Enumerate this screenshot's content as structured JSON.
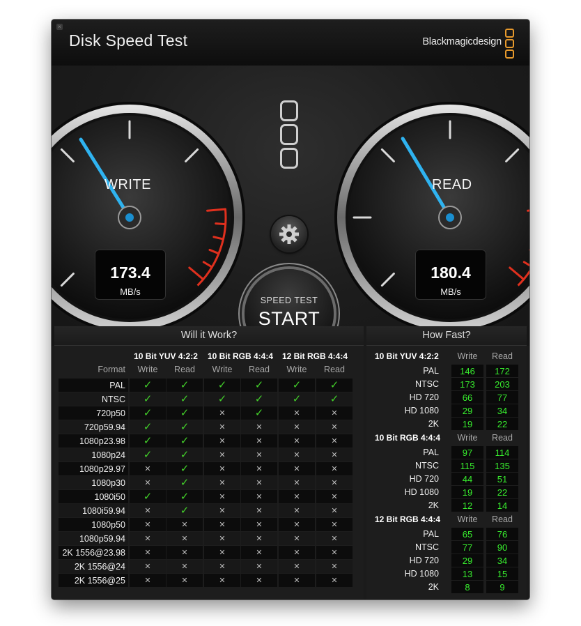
{
  "app": {
    "title": "Disk Speed Test",
    "brand": "Blackmagicdesign",
    "close_icon": "close-icon"
  },
  "gauges": {
    "write": {
      "label": "WRITE",
      "value": "173.4",
      "unit": "MB/s"
    },
    "read": {
      "label": "READ",
      "value": "180.4",
      "unit": "MB/s"
    }
  },
  "controls": {
    "settings_icon": "gear-icon",
    "start_small": "SPEED TEST",
    "start_big": "START"
  },
  "will_it_work": {
    "title": "Will it Work?",
    "format_header": "Format",
    "groups": [
      {
        "name": "10 Bit YUV 4:2:2",
        "cols": [
          "Write",
          "Read"
        ]
      },
      {
        "name": "10 Bit RGB 4:4:4",
        "cols": [
          "Write",
          "Read"
        ]
      },
      {
        "name": "12 Bit RGB 4:4:4",
        "cols": [
          "Write",
          "Read"
        ]
      }
    ],
    "rows": [
      {
        "format": "PAL",
        "marks": [
          1,
          1,
          1,
          1,
          1,
          1
        ]
      },
      {
        "format": "NTSC",
        "marks": [
          1,
          1,
          1,
          1,
          1,
          1
        ]
      },
      {
        "format": "720p50",
        "marks": [
          1,
          1,
          0,
          1,
          0,
          0
        ]
      },
      {
        "format": "720p59.94",
        "marks": [
          1,
          1,
          0,
          0,
          0,
          0
        ]
      },
      {
        "format": "1080p23.98",
        "marks": [
          1,
          1,
          0,
          0,
          0,
          0
        ]
      },
      {
        "format": "1080p24",
        "marks": [
          1,
          1,
          0,
          0,
          0,
          0
        ]
      },
      {
        "format": "1080p29.97",
        "marks": [
          0,
          1,
          0,
          0,
          0,
          0
        ]
      },
      {
        "format": "1080p30",
        "marks": [
          0,
          1,
          0,
          0,
          0,
          0
        ]
      },
      {
        "format": "1080i50",
        "marks": [
          1,
          1,
          0,
          0,
          0,
          0
        ]
      },
      {
        "format": "1080i59.94",
        "marks": [
          0,
          1,
          0,
          0,
          0,
          0
        ]
      },
      {
        "format": "1080p50",
        "marks": [
          0,
          0,
          0,
          0,
          0,
          0
        ]
      },
      {
        "format": "1080p59.94",
        "marks": [
          0,
          0,
          0,
          0,
          0,
          0
        ]
      },
      {
        "format": "2K 1556@23.98",
        "marks": [
          0,
          0,
          0,
          0,
          0,
          0
        ]
      },
      {
        "format": "2K 1556@24",
        "marks": [
          0,
          0,
          0,
          0,
          0,
          0
        ]
      },
      {
        "format": "2K 1556@25",
        "marks": [
          0,
          0,
          0,
          0,
          0,
          0
        ]
      }
    ]
  },
  "how_fast": {
    "title": "How Fast?",
    "write_label": "Write",
    "read_label": "Read",
    "groups": [
      {
        "name": "10 Bit YUV 4:2:2",
        "rows": [
          {
            "format": "PAL",
            "write": "146",
            "read": "172"
          },
          {
            "format": "NTSC",
            "write": "173",
            "read": "203"
          },
          {
            "format": "HD 720",
            "write": "66",
            "read": "77"
          },
          {
            "format": "HD 1080",
            "write": "29",
            "read": "34"
          },
          {
            "format": "2K",
            "write": "19",
            "read": "22"
          }
        ]
      },
      {
        "name": "10 Bit RGB 4:4:4",
        "rows": [
          {
            "format": "PAL",
            "write": "97",
            "read": "114"
          },
          {
            "format": "NTSC",
            "write": "115",
            "read": "135"
          },
          {
            "format": "HD 720",
            "write": "44",
            "read": "51"
          },
          {
            "format": "HD 1080",
            "write": "19",
            "read": "22"
          },
          {
            "format": "2K",
            "write": "12",
            "read": "14"
          }
        ]
      },
      {
        "name": "12 Bit RGB 4:4:4",
        "rows": [
          {
            "format": "PAL",
            "write": "65",
            "read": "76"
          },
          {
            "format": "NTSC",
            "write": "77",
            "read": "90"
          },
          {
            "format": "HD 720",
            "write": "29",
            "read": "34"
          },
          {
            "format": "HD 1080",
            "write": "13",
            "read": "15"
          },
          {
            "format": "2K",
            "write": "8",
            "read": "9"
          }
        ]
      }
    ]
  },
  "colors": {
    "accent_needle": "#2fb3f0",
    "ok_green": "#43d12a",
    "value_green": "#38ee2e",
    "redline": "#e0301e",
    "brand_orange": "#e89a2c"
  }
}
